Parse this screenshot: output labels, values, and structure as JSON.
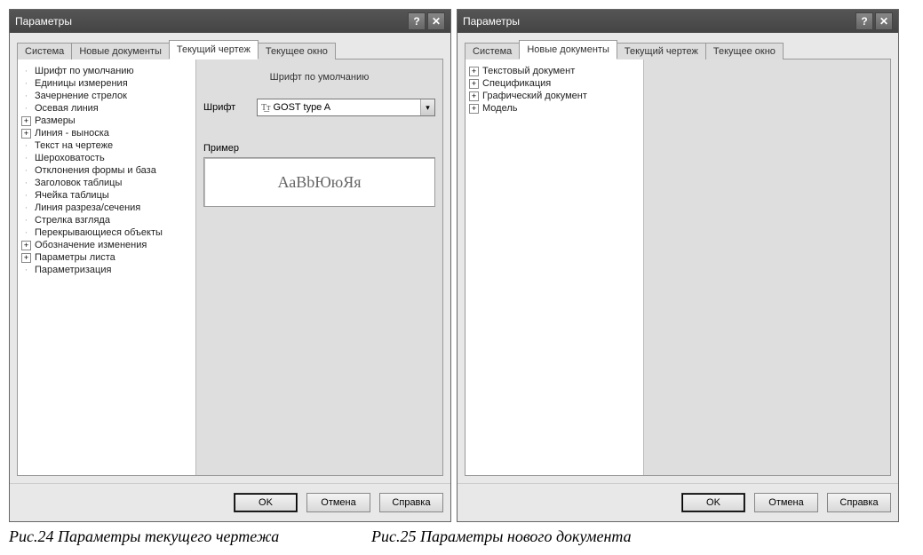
{
  "windowA": {
    "title": "Параметры",
    "tabs": [
      "Система",
      "Новые документы",
      "Текущий чертеж",
      "Текущее окно"
    ],
    "tree": [
      {
        "expander": "",
        "label": "Шрифт по умолчанию"
      },
      {
        "expander": "",
        "label": "Единицы измерения"
      },
      {
        "expander": "",
        "label": "Зачернение стрелок"
      },
      {
        "expander": "",
        "label": "Осевая линия"
      },
      {
        "expander": "+",
        "label": "Размеры"
      },
      {
        "expander": "+",
        "label": "Линия - выноска"
      },
      {
        "expander": "",
        "label": "Текст на чертеже"
      },
      {
        "expander": "",
        "label": "Шероховатость"
      },
      {
        "expander": "",
        "label": "Отклонения формы и база"
      },
      {
        "expander": "",
        "label": "Заголовок таблицы"
      },
      {
        "expander": "",
        "label": "Ячейка таблицы"
      },
      {
        "expander": "",
        "label": "Линия разреза/сечения"
      },
      {
        "expander": "",
        "label": "Стрелка взгляда"
      },
      {
        "expander": "",
        "label": "Перекрывающиеся объекты"
      },
      {
        "expander": "+",
        "label": "Обозначение изменения"
      },
      {
        "expander": "+",
        "label": "Параметры листа"
      },
      {
        "expander": "",
        "label": "Параметризация"
      }
    ],
    "rightPane": {
      "heading": "Шрифт по умолчанию",
      "fontLabel": "Шрифт",
      "fontValue": "GOST type A",
      "previewLabel": "Пример",
      "previewText": "АаВbЮюЯя"
    },
    "buttons": {
      "ok": "OK",
      "cancel": "Отмена",
      "help": "Справка"
    }
  },
  "windowB": {
    "title": "Параметры",
    "tabs": [
      "Система",
      "Новые документы",
      "Текущий чертеж",
      "Текущее окно"
    ],
    "tree": [
      {
        "expander": "+",
        "label": "Текстовый документ"
      },
      {
        "expander": "+",
        "label": "Спецификация"
      },
      {
        "expander": "+",
        "label": "Графический документ"
      },
      {
        "expander": "+",
        "label": "Модель"
      }
    ],
    "buttons": {
      "ok": "OK",
      "cancel": "Отмена",
      "help": "Справка"
    }
  },
  "captions": {
    "left": "Рис.24 Параметры текущего чертежа",
    "right": "Рис.25 Параметры нового документа"
  }
}
